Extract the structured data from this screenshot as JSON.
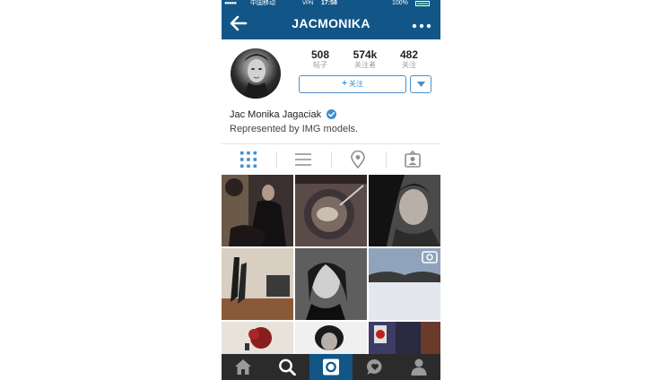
{
  "status_bar": {
    "signal": "●●●●●",
    "carrier": "中国移动",
    "network": "VPN",
    "time": "17:58",
    "battery": "100%"
  },
  "nav": {
    "title": "JACMONIKA",
    "back_icon": "arrow-left-icon",
    "more_icon": "ellipsis-icon"
  },
  "profile": {
    "stats": [
      {
        "value": "508",
        "label": "帖子"
      },
      {
        "value": "574k",
        "label": "关注者"
      },
      {
        "value": "482",
        "label": "关注"
      }
    ],
    "follow_button": {
      "plus": "+",
      "label": "关注"
    },
    "full_name": "Jac Monika Jagaciak",
    "bio": "Represented by IMG models."
  },
  "view_tabs": [
    {
      "name": "grid-view",
      "icon": "grid-icon",
      "active": true
    },
    {
      "name": "list-view",
      "icon": "list-icon",
      "active": false
    },
    {
      "name": "location-view",
      "icon": "location-pin-icon",
      "active": false
    },
    {
      "name": "tagged-view",
      "icon": "tagged-person-icon",
      "active": false
    }
  ],
  "bottom_tabs": [
    {
      "name": "home",
      "icon": "home-icon",
      "active": false
    },
    {
      "name": "explore",
      "icon": "search-icon",
      "active": false
    },
    {
      "name": "camera",
      "icon": "camera-icon",
      "active": true
    },
    {
      "name": "activity",
      "icon": "heart-bubble-icon",
      "active": false
    },
    {
      "name": "profile",
      "icon": "person-icon",
      "active": false
    }
  ],
  "colors": {
    "header": "#125688",
    "accent": "#3f8fd0",
    "tabbar": "#2b2b2b",
    "battery_fill": "#4cd964"
  }
}
